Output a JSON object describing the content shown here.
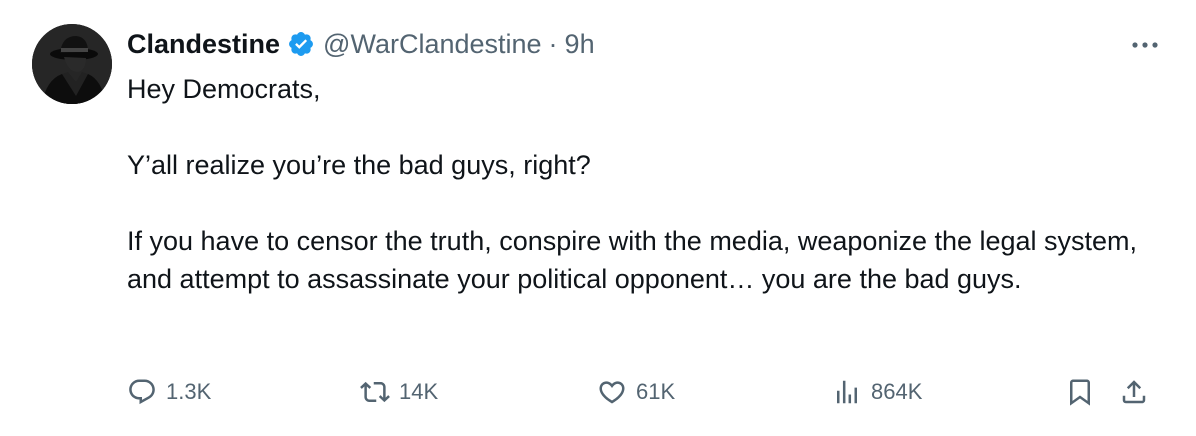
{
  "author": {
    "name": "Clandestine",
    "handle": "@WarClandestine",
    "separator": "·",
    "time": "9h",
    "verified": true,
    "verified_color": "#1d9bf0"
  },
  "tweet": {
    "paragraphs": [
      "Hey Democrats,",
      "Y’all realize you’re the bad guys, right?",
      "If you have to censor the truth, conspire with the media, weaponize the legal system, and attempt to assassinate your political opponent… you are the bad guys."
    ]
  },
  "actions": {
    "replies": "1.3K",
    "reposts": "14K",
    "likes": "61K",
    "views": "864K"
  },
  "icons": {
    "reply": "speech-bubble-icon",
    "repost": "repost-arrows-icon",
    "like": "heart-icon",
    "views": "bar-chart-icon",
    "bookmark": "bookmark-icon",
    "share": "share-upload-icon",
    "more": "more-dots-icon"
  },
  "colors": {
    "text": "#0f1419",
    "secondary": "#536471",
    "accent": "#1d9bf0"
  }
}
